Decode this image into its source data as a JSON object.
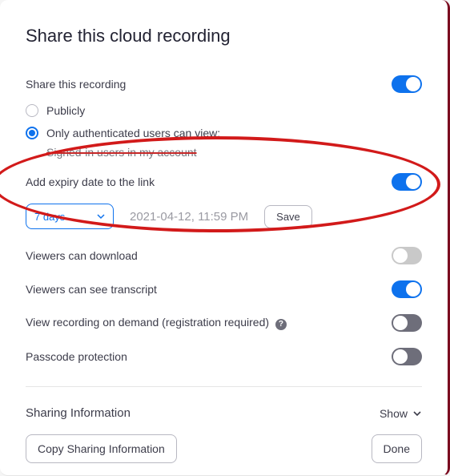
{
  "title": "Share this cloud recording",
  "share_recording": {
    "label": "Share this recording",
    "value": true
  },
  "access": {
    "public_label": "Publicly",
    "auth_label": "Only authenticated users can view:",
    "selected": "auth",
    "auth_sublabel": "Signed-in users in my account"
  },
  "expiry": {
    "label": "Add expiry date to the link",
    "enabled": true,
    "duration_selected": "7 days",
    "date_preview": "2021-04-12, 11:59 PM",
    "save_label": "Save"
  },
  "viewers_download": {
    "label": "Viewers can download",
    "value": false
  },
  "viewers_transcript": {
    "label": "Viewers can see transcript",
    "value": true
  },
  "on_demand": {
    "label": "View recording on demand (registration required)",
    "value": false
  },
  "passcode": {
    "label": "Passcode protection",
    "value": false
  },
  "sharing_info": {
    "label": "Sharing Information",
    "toggle": "Show"
  },
  "footer": {
    "copy_label": "Copy Sharing Information",
    "done_label": "Done"
  }
}
